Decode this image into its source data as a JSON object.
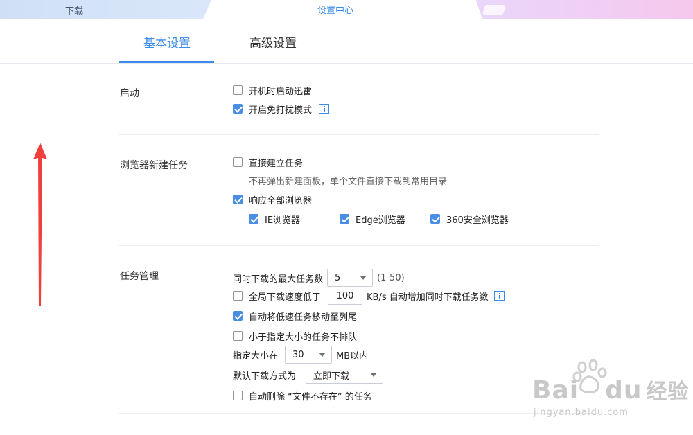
{
  "tabs": {
    "download": "下载",
    "settings": "设置中心"
  },
  "subtabs": {
    "basic": "基本设置",
    "advanced": "高级设置"
  },
  "startup": {
    "title": "启动",
    "boot_start": {
      "label": "开机时启动迅雷",
      "checked": false
    },
    "no_disturb": {
      "label": "开启免打扰模式",
      "checked": true
    }
  },
  "browser": {
    "title": "浏览器新建任务",
    "direct_create": {
      "label": "直接建立任务",
      "checked": false
    },
    "direct_hint": "不再弹出新建面板，单个文件直接下载到常用目录",
    "respond_all": {
      "label": "响应全部浏览器",
      "checked": true
    },
    "ie": {
      "label": "IE浏览器",
      "checked": true
    },
    "edge": {
      "label": "Edge浏览器",
      "checked": true
    },
    "b360": {
      "label": "360安全浏览器",
      "checked": true
    }
  },
  "task": {
    "title": "任务管理",
    "max_tasks_label": "同时下载的最大任务数",
    "max_tasks_value": "5",
    "max_tasks_range": "(1-50)",
    "speed_low": {
      "label": "全局下载速度低于",
      "checked": false
    },
    "speed_value": "100",
    "speed_suffix": "KB/s 自动增加同时下载任务数",
    "move_slow": {
      "label": "自动将低速任务移动至列尾",
      "checked": true
    },
    "small_no_queue": {
      "label": "小于指定大小的任务不排队",
      "checked": false
    },
    "size_label": "指定大小在",
    "size_value": "30",
    "size_unit": "MB以内",
    "default_mode_label": "默认下载方式为",
    "default_mode_value": "立即下载",
    "auto_delete": {
      "label": "自动删除 “文件不存在” 的任务",
      "checked": false
    }
  },
  "watermark": {
    "brand": "Bai",
    "brand2": "du",
    "cn": "经验",
    "url": "jingyan.baidu.com"
  },
  "colors": {
    "accent": "#3b8be8",
    "checkbox": "#4a8ee4",
    "arrow": "#f0403c"
  }
}
